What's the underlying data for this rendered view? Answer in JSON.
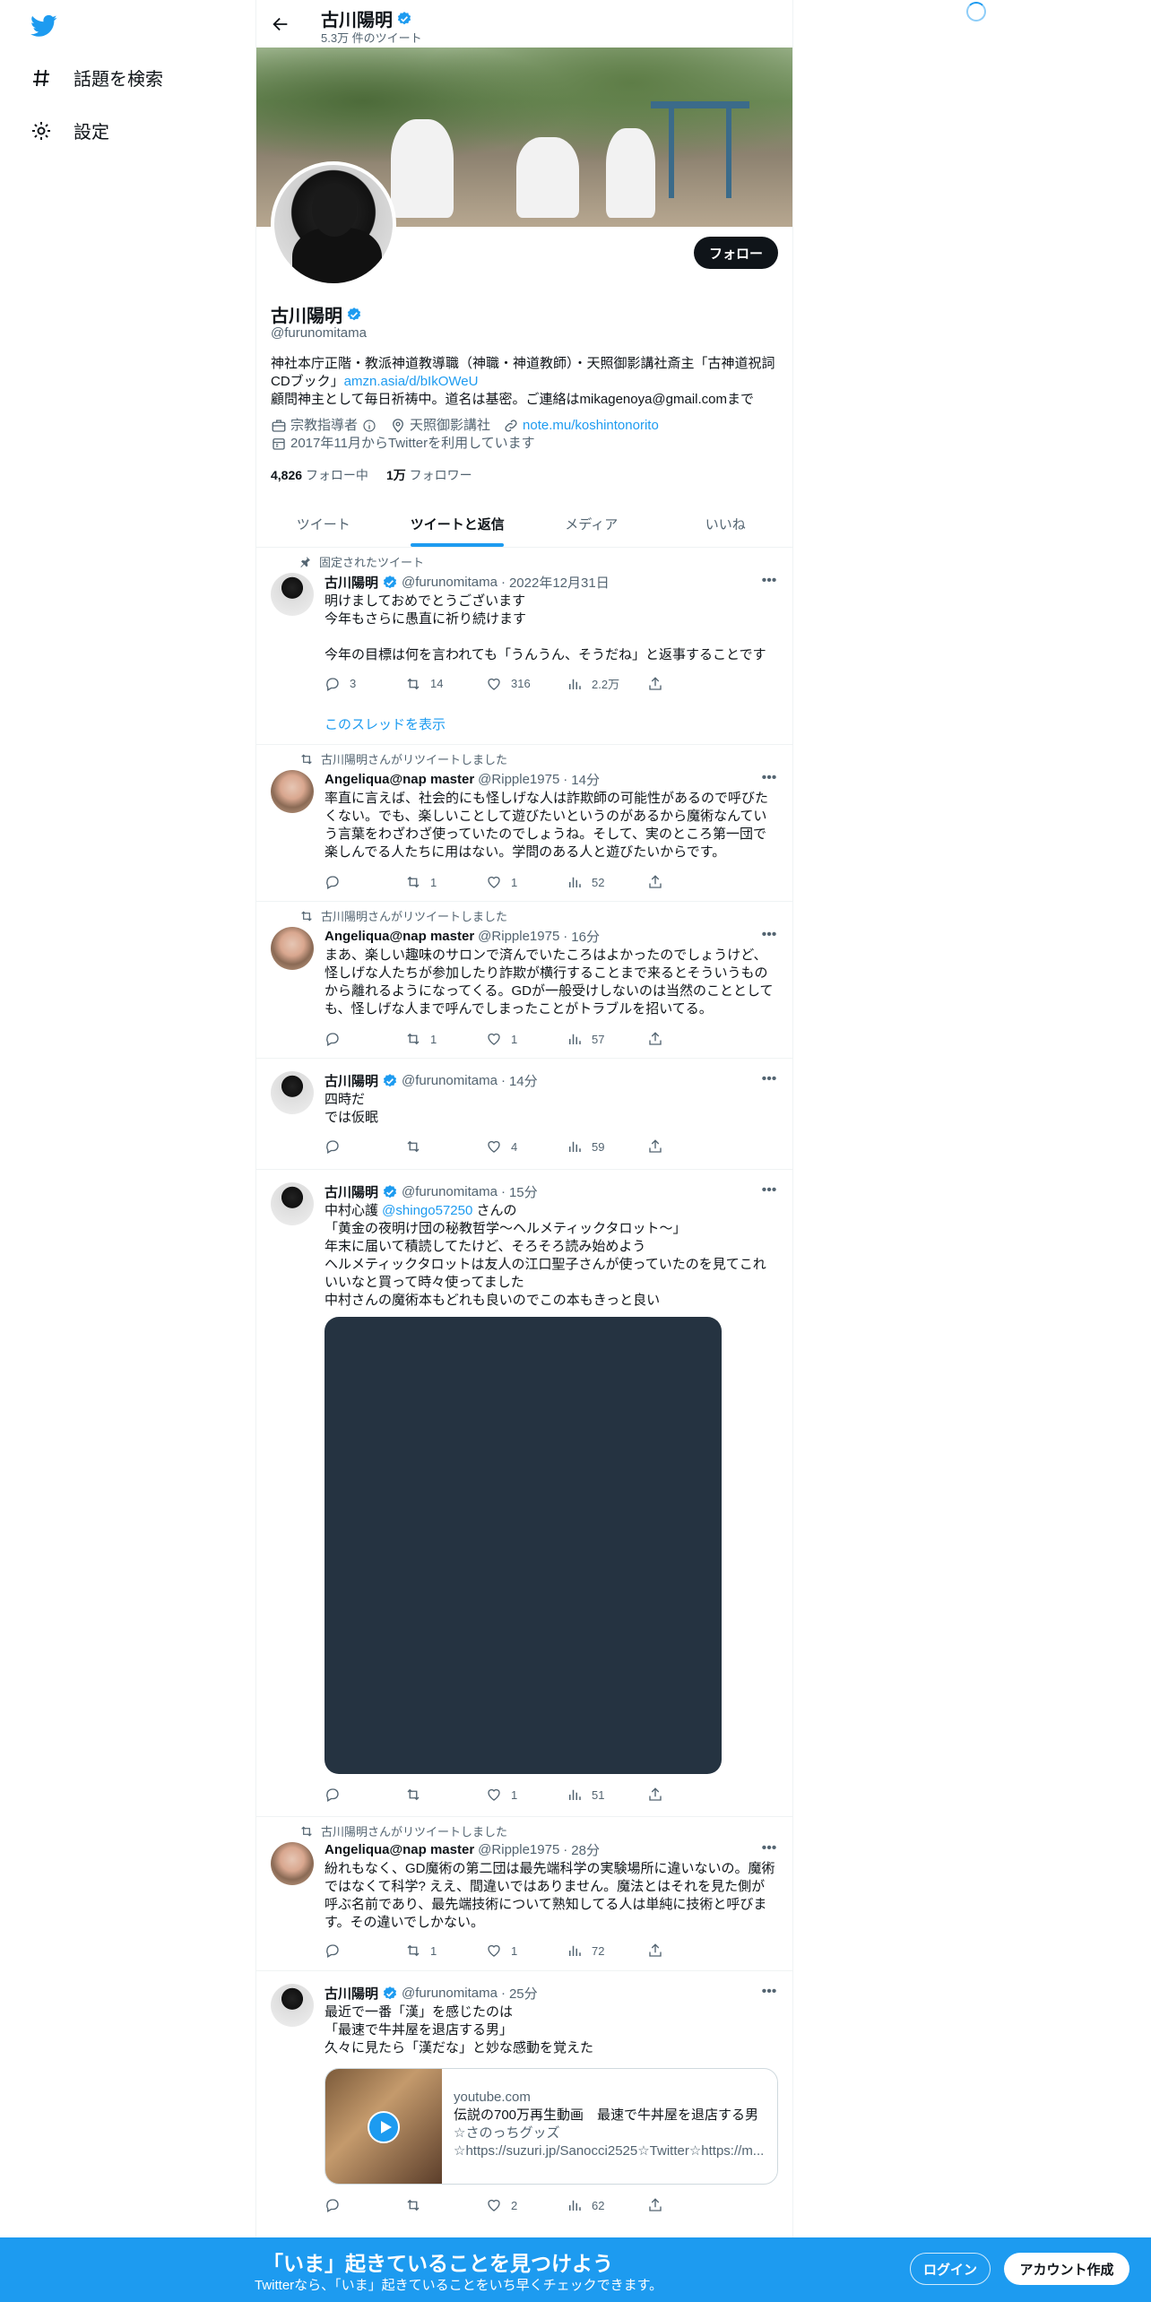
{
  "nav": {
    "explore_label": "話題を検索",
    "settings_label": "設定"
  },
  "header": {
    "name": "古川陽明",
    "tweet_count": "5.3万 件のツイート"
  },
  "profile": {
    "follow_label": "フォロー",
    "name": "古川陽明",
    "handle": "@furunomitama",
    "bio_line1": "神社本庁正階・教派神道教導職（神職・神道教師）・天照御影講社斎主「古神道祝詞CDブック」",
    "bio_link": "amzn.asia/d/bIkOWeU",
    "bio_line2": "顧問神主として毎日祈祷中。道名は基密。ご連絡はmikagenoya@gmail.comまで",
    "category": "宗教指導者",
    "location": "天照御影講社",
    "website": "note.mu/koshintonorito",
    "joined": "2017年11月からTwitterを利用しています",
    "following_count": "4,826",
    "following_label": "フォロー中",
    "followers_count": "1万",
    "followers_label": "フォロワー"
  },
  "tabs": [
    "ツイート",
    "ツイートと返信",
    "メディア",
    "いいね"
  ],
  "tweets": [
    {
      "context": "固定されたツイート",
      "name": "古川陽明",
      "handle": "@furunomitama",
      "time": "2022年12月31日",
      "text": "明けましておめでとうございます\n今年もさらに愚直に祈り続けます\n\n今年の目標は何を言われても「うんうん、そうだね」と返事することです",
      "replies": "3",
      "retweets": "14",
      "likes": "316",
      "views": "2.2万",
      "thread_link": "このスレッドを表示"
    },
    {
      "context": "古川陽明さんがリツイートしました",
      "name": "Angeliqua@nap master",
      "handle": "@Ripple1975",
      "time": "14分",
      "text": "率直に言えば、社会的にも怪しげな人は詐欺師の可能性があるので呼びたくない。でも、楽しいことして遊びたいというのがあるから魔術なんていう言葉をわざわざ使っていたのでしょうね。そして、実のところ第一団で楽しんでる人たちに用はない。学問のある人と遊びたいからです。",
      "replies": "",
      "retweets": "1",
      "likes": "1",
      "views": "52"
    },
    {
      "context": "古川陽明さんがリツイートしました",
      "name": "Angeliqua@nap master",
      "handle": "@Ripple1975",
      "time": "16分",
      "text": "まあ、楽しい趣味のサロンで済んでいたころはよかったのでしょうけど、怪しげな人たちが参加したり詐欺が横行することまで来るとそういうものから離れるようになってくる。GDが一般受けしないのは当然のこととしても、怪しげな人まで呼んでしまったことがトラブルを招いてる。",
      "replies": "",
      "retweets": "1",
      "likes": "1",
      "views": "57"
    },
    {
      "name": "古川陽明",
      "handle": "@furunomitama",
      "time": "14分",
      "text": "四時だ\nでは仮眠",
      "replies": "",
      "retweets": "",
      "likes": "4",
      "views": "59"
    },
    {
      "name": "古川陽明",
      "handle": "@furunomitama",
      "time": "15分",
      "text_pre": "中村心護 ",
      "mention": "@shingo57250",
      "text_post": " さんの\n「黄金の夜明け団の秘教哲学～ヘルメティックタロット～」\n年末に届いて積読してたけど、そろそろ読み始めよう\nヘルメティックタロットは友人の江口聖子さんが使っていたのを見てこれいいなと買って時々使ってました\n中村さんの魔術本もどれも良いのでこの本もきっと良い",
      "replies": "",
      "retweets": "",
      "likes": "1",
      "views": "51"
    },
    {
      "context": "古川陽明さんがリツイートしました",
      "name": "Angeliqua@nap master",
      "handle": "@Ripple1975",
      "time": "28分",
      "text": "紛れもなく、GD魔術の第二団は最先端科学の実験場所に違いないの。魔術ではなくて科学? ええ、間違いではありません。魔法とはそれを見た側が呼ぶ名前であり、最先端技術について熟知してる人は単純に技術と呼びます。その違いでしかない。",
      "replies": "",
      "retweets": "1",
      "likes": "1",
      "views": "72"
    },
    {
      "name": "古川陽明",
      "handle": "@furunomitama",
      "time": "25分",
      "text": "最近で一番「漢」を感じたのは\n「最速で牛丼屋を退店する男」\n久々に見たら「漢だな」と妙な感動を覚えた",
      "card_domain": "youtube.com",
      "card_title": "伝説の700万再生動画　最速で牛丼屋を退店する男",
      "card_desc1": "☆さのっちグッズ",
      "card_desc2": "☆https://suzuri.jp/Sanocci2525☆Twitter☆https://m...",
      "replies": "",
      "retweets": "",
      "likes": "2",
      "views": "62"
    }
  ],
  "bottom": {
    "headline": "「いま」起きていることを見つけよう",
    "subline": "Twitterなら、「いま」起きていることをいち早くチェックできます。",
    "login_label": "ログイン",
    "signup_label": "アカウント作成"
  },
  "colors": {
    "accent": "#1d9bf0",
    "text": "#0f1419",
    "muted": "#536471"
  }
}
